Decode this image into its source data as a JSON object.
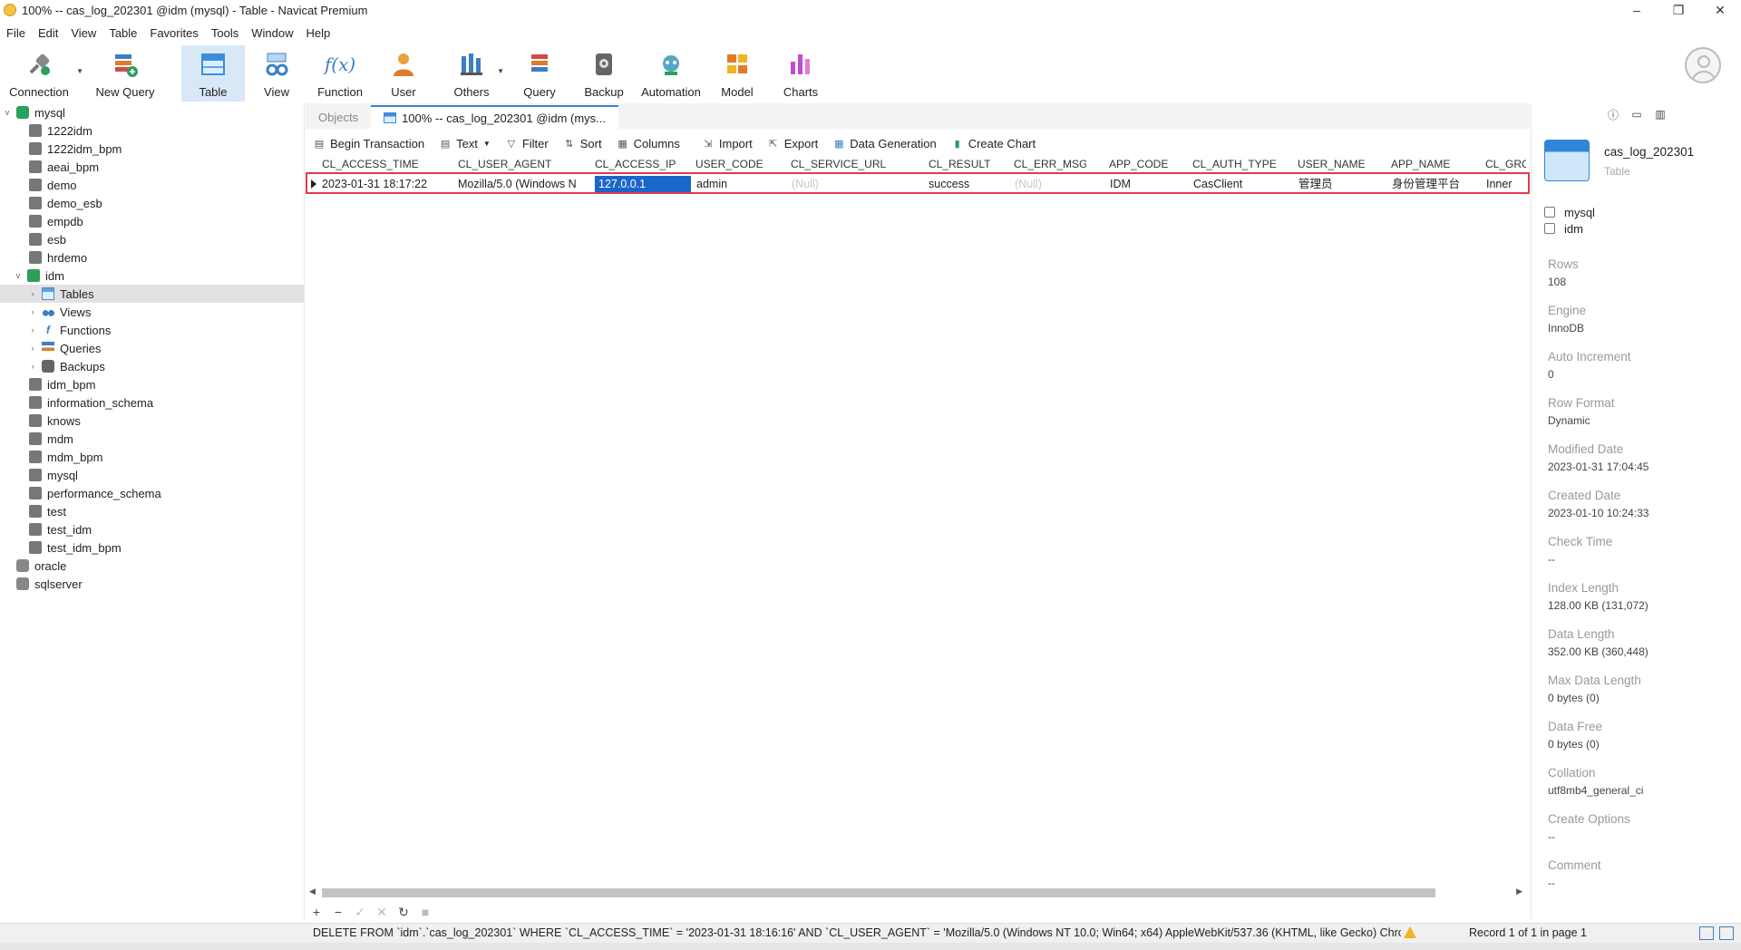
{
  "window": {
    "title": "100% -- cas_log_202301 @idm (mysql) - Table - Navicat Premium",
    "controls": [
      "–",
      "❐",
      "✕"
    ]
  },
  "menu": [
    "File",
    "Edit",
    "View",
    "Table",
    "Favorites",
    "Tools",
    "Window",
    "Help"
  ],
  "toolbar": {
    "buttons": [
      {
        "label": "Connection",
        "icon": "connection-icon"
      },
      {
        "label": "New Query",
        "icon": "new-query-icon"
      },
      {
        "label": "Table",
        "icon": "table-icon"
      },
      {
        "label": "View",
        "icon": "view-icon"
      },
      {
        "label": "Function",
        "icon": "function-icon"
      },
      {
        "label": "User",
        "icon": "user-icon"
      },
      {
        "label": "Others",
        "icon": "others-icon"
      },
      {
        "label": "Query",
        "icon": "query-icon"
      },
      {
        "label": "Backup",
        "icon": "backup-icon"
      },
      {
        "label": "Automation",
        "icon": "automation-icon"
      },
      {
        "label": "Model",
        "icon": "model-icon"
      },
      {
        "label": "Charts",
        "icon": "charts-icon"
      }
    ],
    "function_glyph": "f(x)"
  },
  "tree": [
    {
      "label": "mysql",
      "type": "conn",
      "expanded": true
    },
    {
      "label": "1222idm",
      "type": "db"
    },
    {
      "label": "1222idm_bpm",
      "type": "db"
    },
    {
      "label": "aeai_bpm",
      "type": "db"
    },
    {
      "label": "demo",
      "type": "db"
    },
    {
      "label": "demo_esb",
      "type": "db"
    },
    {
      "label": "empdb",
      "type": "db"
    },
    {
      "label": "esb",
      "type": "db"
    },
    {
      "label": "hrdemo",
      "type": "db"
    },
    {
      "label": "idm",
      "type": "db-green",
      "expanded": true
    },
    {
      "label": "Tables",
      "type": "tables",
      "selected": true
    },
    {
      "label": "Views",
      "type": "views"
    },
    {
      "label": "Functions",
      "type": "funcs"
    },
    {
      "label": "Queries",
      "type": "queries"
    },
    {
      "label": "Backups",
      "type": "backups"
    },
    {
      "label": "idm_bpm",
      "type": "db"
    },
    {
      "label": "information_schema",
      "type": "db"
    },
    {
      "label": "knows",
      "type": "db"
    },
    {
      "label": "mdm",
      "type": "db"
    },
    {
      "label": "mdm_bpm",
      "type": "db"
    },
    {
      "label": "mysql",
      "type": "db"
    },
    {
      "label": "performance_schema",
      "type": "db"
    },
    {
      "label": "test",
      "type": "db"
    },
    {
      "label": "test_idm",
      "type": "db"
    },
    {
      "label": "test_idm_bpm",
      "type": "db"
    },
    {
      "label": "oracle",
      "type": "conn-gray"
    },
    {
      "label": "sqlserver",
      "type": "conn-gray"
    }
  ],
  "tabs": {
    "objects": "Objects",
    "active": "100% -- cas_log_202301 @idm (mys..."
  },
  "object_toolbar": [
    {
      "label": "Begin Transaction",
      "icon": "transaction-icon"
    },
    {
      "label": "Text",
      "icon": "text-icon",
      "dropdown": true
    },
    {
      "label": "Filter",
      "icon": "filter-icon"
    },
    {
      "label": "Sort",
      "icon": "sort-icon"
    },
    {
      "label": "Columns",
      "icon": "columns-icon"
    },
    {
      "label": "Import",
      "icon": "import-icon"
    },
    {
      "label": "Export",
      "icon": "export-icon"
    },
    {
      "label": "Data Generation",
      "icon": "data-generation-icon"
    },
    {
      "label": "Create Chart",
      "icon": "create-chart-icon"
    }
  ],
  "table": {
    "columns": [
      "CL_ACCESS_TIME",
      "CL_USER_AGENT",
      "CL_ACCESS_IP",
      "USER_CODE",
      "CL_SERVICE_URL",
      "CL_RESULT",
      "CL_ERR_MSG",
      "APP_CODE",
      "CL_AUTH_TYPE",
      "USER_NAME",
      "APP_NAME",
      "CL_GRC"
    ],
    "rows": [
      [
        "2023-01-31 18:17:22",
        "Mozilla/5.0 (Windows N",
        "127.0.0.1",
        "admin",
        "(Null)",
        "success",
        "(Null)",
        "IDM",
        "CasClient",
        "管理员",
        "身份管理平台",
        "Inner"
      ]
    ]
  },
  "pager": {
    "page": "1",
    "controls": [
      "⏮",
      "←",
      "→",
      "⏭",
      "⚙"
    ]
  },
  "status": {
    "sql": "DELETE FROM `idm`.`cas_log_202301` WHERE `CL_ACCESS_TIME` = '2023-01-31 18:16:16' AND `CL_USER_AGENT` = 'Mozilla/5.0 (Windows NT 10.0; Win64; x64) AppleWebKit/537.36 (KHTML, like Gecko) Chro",
    "record": "Record 1 of 1 in page 1"
  },
  "info": {
    "table_name": "cas_log_202301",
    "table_type": "Table",
    "connection": "mysql",
    "database": "idm",
    "properties": [
      {
        "label": "Rows",
        "value": "108"
      },
      {
        "label": "Engine",
        "value": "InnoDB"
      },
      {
        "label": "Auto Increment",
        "value": "0"
      },
      {
        "label": "Row Format",
        "value": "Dynamic"
      },
      {
        "label": "Modified Date",
        "value": "2023-01-31 17:04:45"
      },
      {
        "label": "Created Date",
        "value": "2023-01-10 10:24:33"
      },
      {
        "label": "Check Time",
        "value": "--"
      },
      {
        "label": "Index Length",
        "value": "128.00 KB (131,072)"
      },
      {
        "label": "Data Length",
        "value": "352.00 KB (360,448)"
      },
      {
        "label": "Max Data Length",
        "value": "0 bytes (0)"
      },
      {
        "label": "Data Free",
        "value": "0 bytes (0)"
      },
      {
        "label": "Collation",
        "value": "utf8mb4_general_ci"
      },
      {
        "label": "Create Options",
        "value": "--"
      },
      {
        "label": "Comment",
        "value": "--"
      }
    ]
  },
  "colors": {
    "accent": "#3b7fc4",
    "highlight_border": "#e23a4f",
    "selected_cell": "#1a66c9"
  }
}
